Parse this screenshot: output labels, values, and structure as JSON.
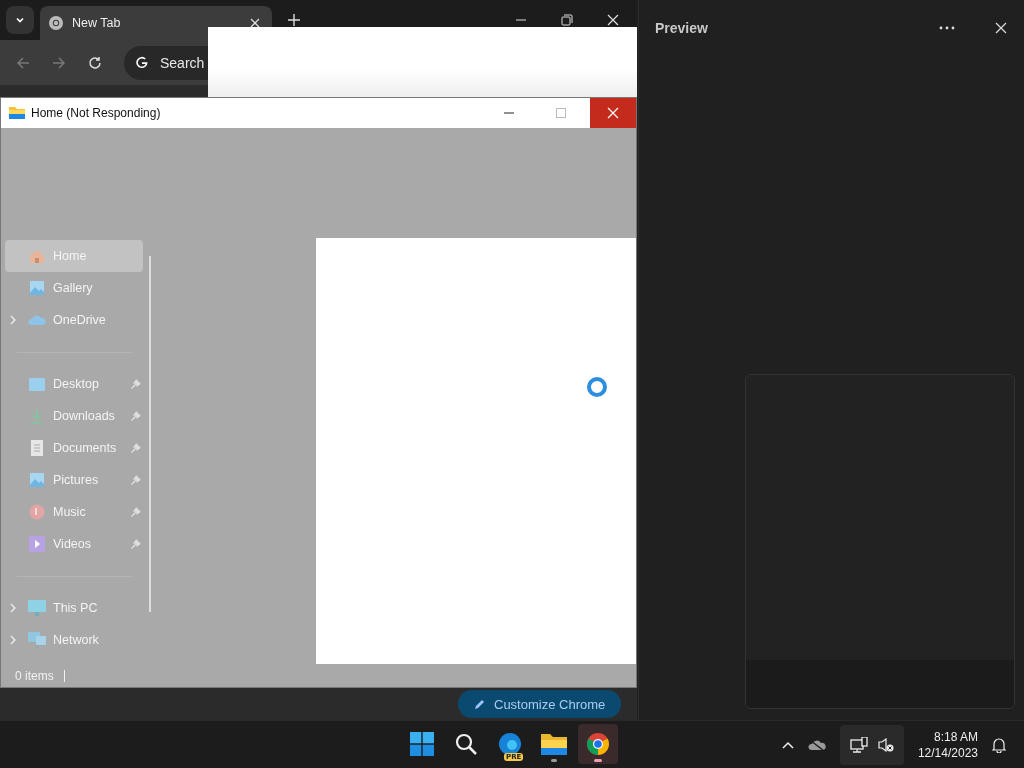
{
  "browser": {
    "tab": {
      "title": "New Tab"
    },
    "omnibox": {
      "placeholder": "Search"
    },
    "customize_button": "Customize Chrome"
  },
  "explorer": {
    "title": "Home (Not Responding)",
    "nav_sections": [
      [
        {
          "label": "Home",
          "kind": "home",
          "expandable": false,
          "pinned": false,
          "selected": true
        },
        {
          "label": "Gallery",
          "kind": "gallery",
          "expandable": false,
          "pinned": false,
          "selected": false
        },
        {
          "label": "OneDrive",
          "kind": "cloud",
          "expandable": true,
          "pinned": false,
          "selected": false
        }
      ],
      [
        {
          "label": "Desktop",
          "kind": "desktop",
          "expandable": false,
          "pinned": true,
          "selected": false
        },
        {
          "label": "Downloads",
          "kind": "download",
          "expandable": false,
          "pinned": true,
          "selected": false
        },
        {
          "label": "Documents",
          "kind": "document",
          "expandable": false,
          "pinned": true,
          "selected": false
        },
        {
          "label": "Pictures",
          "kind": "pictures",
          "expandable": false,
          "pinned": true,
          "selected": false
        },
        {
          "label": "Music",
          "kind": "music",
          "expandable": false,
          "pinned": true,
          "selected": false
        },
        {
          "label": "Videos",
          "kind": "videos",
          "expandable": false,
          "pinned": true,
          "selected": false
        }
      ],
      [
        {
          "label": "This PC",
          "kind": "pc",
          "expandable": true,
          "pinned": false,
          "selected": false
        },
        {
          "label": "Network",
          "kind": "network",
          "expandable": true,
          "pinned": false,
          "selected": false
        }
      ]
    ],
    "status": "0 items"
  },
  "preview": {
    "title": "Preview"
  },
  "taskbar": {
    "apps": [
      {
        "kind": "start",
        "running": false,
        "selected": false
      },
      {
        "kind": "search",
        "running": false,
        "selected": false
      },
      {
        "kind": "edge",
        "running": false,
        "selected": false
      },
      {
        "kind": "explorer",
        "running": true,
        "selected": false
      },
      {
        "kind": "chrome",
        "running": true,
        "selected": true
      }
    ],
    "badge": "PRE",
    "time": "8:18 AM",
    "date": "12/14/2023"
  }
}
